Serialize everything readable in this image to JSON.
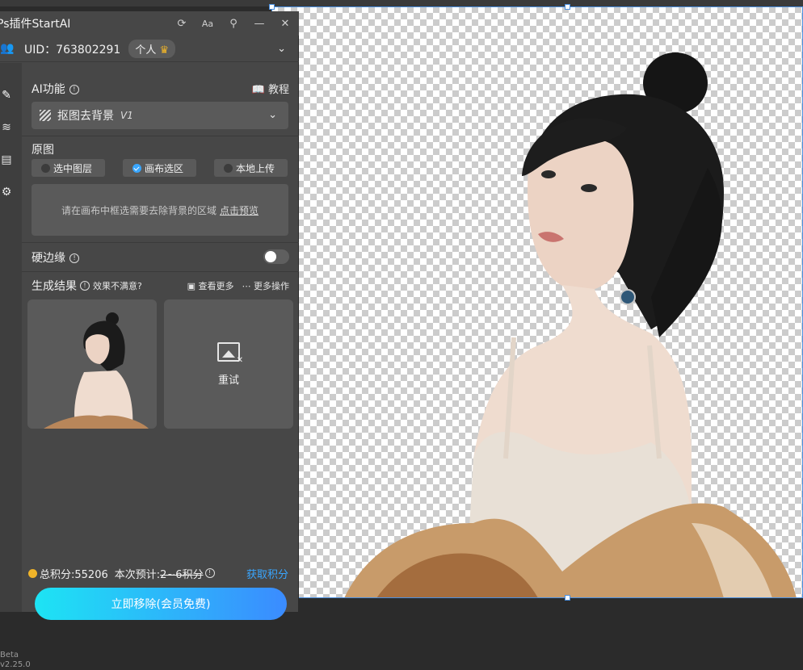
{
  "panel": {
    "title": "Ps插件StartAI",
    "title_icons": [
      "refresh-icon",
      "font-size-icon",
      "pin-icon",
      "minimize-icon",
      "close-icon"
    ],
    "font_icon_label": "Aa",
    "uid": "UID：763802291",
    "plan_badge": "个人"
  },
  "ai": {
    "section_label": "AI功能",
    "tutorial": "教程",
    "function_select": "抠图去背景",
    "version": "V1"
  },
  "source": {
    "label": "原图",
    "options": [
      "选中图层",
      "画布选区",
      "本地上传"
    ],
    "selected": "画布选区",
    "hint": "请在画布中框选需要去除背景的区域",
    "preview_link": "点击预览"
  },
  "hard_edge": {
    "label": "硬边缘",
    "enabled": false
  },
  "results": {
    "label": "生成结果",
    "feedback": "效果不满意?",
    "view_more": "查看更多",
    "more_actions": "更多操作",
    "retry": "重试"
  },
  "footer": {
    "total_points_label": "总积分:55206",
    "estimate_label": "本次预计:",
    "estimate_value": "2~6积分",
    "get_points": "获取积分",
    "cta": "立即移除(会员免费)",
    "version_line1": "Beta",
    "version_line2": "v2.25.0"
  },
  "colors": {
    "accent": "#39a6ff",
    "cta_start": "#1de4f4",
    "cta_end": "#3b8bff",
    "coin": "#f0b429"
  }
}
